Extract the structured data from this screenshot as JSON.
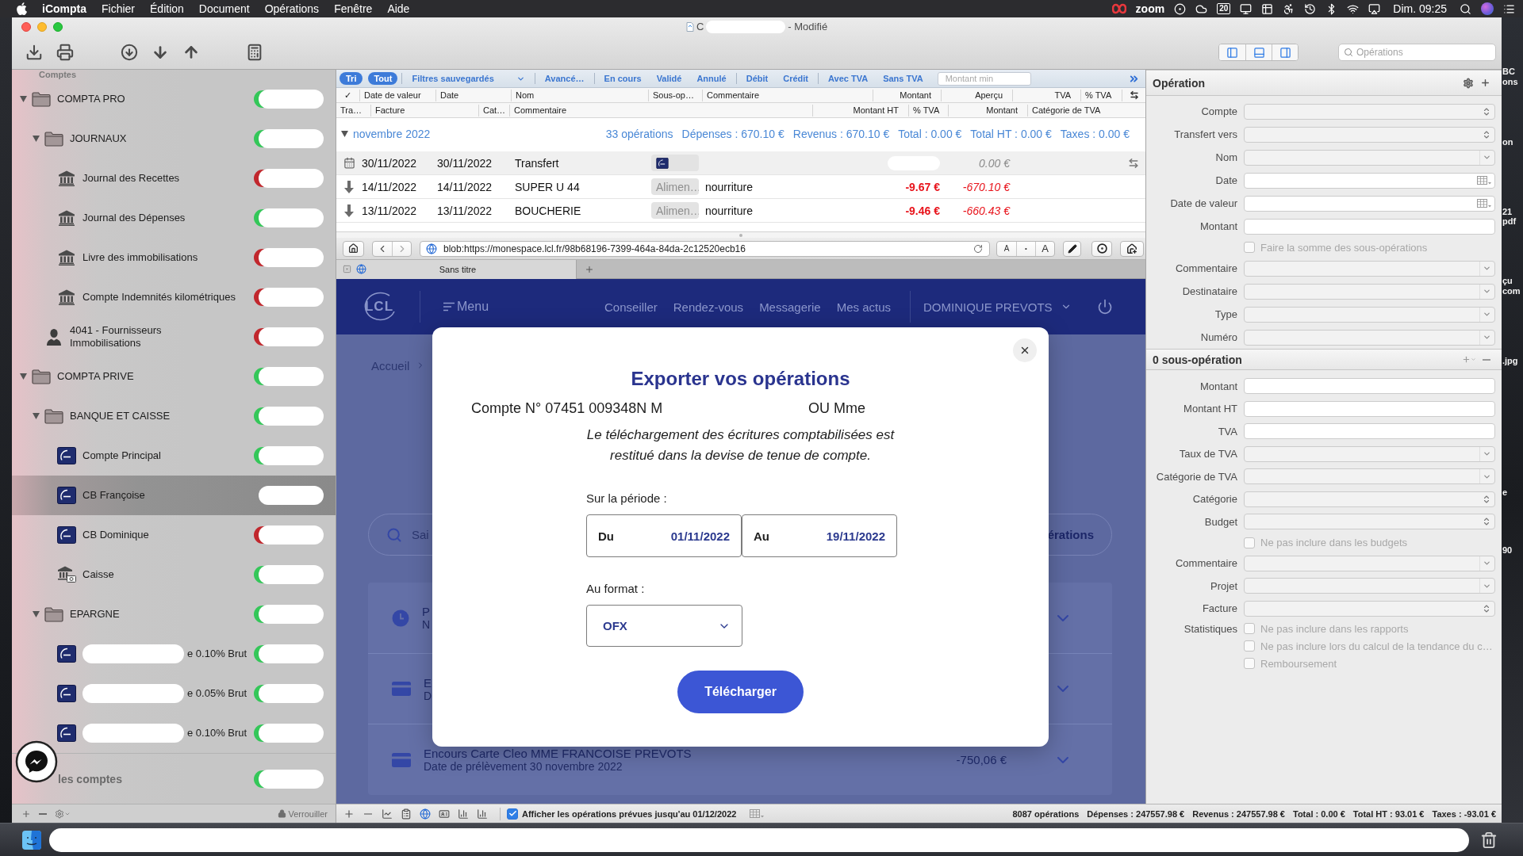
{
  "menu_bar": {
    "app": "iCompta",
    "menus": [
      "Fichier",
      "Édition",
      "Document",
      "Opérations",
      "Fenêtre",
      "Aide"
    ],
    "zoom_label": "zoom",
    "day_badge": "20",
    "clock": "Dim. 09:25"
  },
  "window": {
    "title_start": "C",
    "title_end": "- Modifié",
    "view_toggles": [
      {
        "on": true
      },
      {
        "on": true
      },
      {
        "on": true
      }
    ],
    "search": {
      "placeholder": "Opérations"
    }
  },
  "sidebar": {
    "heading": "Comptes",
    "items": [
      {
        "kind": "folder",
        "label": "COMPTA PRO",
        "expanded": true,
        "selected": false,
        "color": "#34c759",
        "children": [
          {
            "kind": "folder",
            "label": "JOURNAUX",
            "expanded": true,
            "selected": false,
            "color": "#34c759",
            "children": [
              {
                "kind": "bank",
                "label": "Journal des Recettes",
                "selected": false,
                "color": "#c1272d"
              },
              {
                "kind": "bank",
                "label": "Journal des Dépenses",
                "selected": false,
                "color": "#34c759"
              },
              {
                "kind": "bank",
                "label": "Livre des immobilisations",
                "selected": false,
                "color": "#c1272d"
              },
              {
                "kind": "bank",
                "label": "Compte Indemnités kilométriques",
                "selected": false,
                "color": "#c1272d"
              }
            ]
          },
          {
            "kind": "person",
            "label": "4041 - Fournisseurs Immobilisations",
            "selected": false,
            "color": "#c1272d"
          }
        ]
      },
      {
        "kind": "folder",
        "label": "COMPTA PRIVE",
        "expanded": true,
        "selected": false,
        "color": "#34c759",
        "children": [
          {
            "kind": "folder",
            "label": "BANQUE ET CAISSE",
            "expanded": true,
            "selected": false,
            "color": "#34c759",
            "children": [
              {
                "kind": "card",
                "label": "Compte Principal",
                "selected": false,
                "color": "#34c759"
              },
              {
                "kind": "card",
                "label": "CB Françoise",
                "selected": true
              },
              {
                "kind": "card",
                "label": "CB Dominique",
                "selected": false,
                "color": "#c1272d"
              },
              {
                "kind": "cash",
                "label": "Caisse",
                "selected": false,
                "color": "#34c759"
              }
            ]
          },
          {
            "kind": "folder",
            "label": "EPARGNE",
            "expanded": true,
            "selected": false,
            "color": "#34c759",
            "children": [
              {
                "kind": "card",
                "label": "e 0.10% Brut",
                "redacted": true,
                "selected": false,
                "color": "#34c759"
              },
              {
                "kind": "card",
                "label": "e 0.05% Brut",
                "redacted": true,
                "selected": false,
                "color": "#34c759"
              },
              {
                "kind": "card",
                "label": "e 0.10% Brut",
                "redacted": true,
                "selected": false,
                "color": "#34c759"
              }
            ]
          }
        ]
      }
    ],
    "total": {
      "label": "les comptes",
      "color": "#34c759"
    },
    "footer": {
      "lock_label": "Verrouiller"
    }
  },
  "filter_bar": {
    "sort_label": "Tri",
    "groups": [
      {
        "items": [
          {
            "kind": "toggle",
            "label": "Tout",
            "selected": true
          }
        ]
      },
      {
        "items": [
          {
            "kind": "menu",
            "label": "Filtres sauvegardés",
            "selected": false
          }
        ]
      },
      {
        "items": [
          {
            "kind": "toggle",
            "label": "Avancé…",
            "selected": false
          }
        ]
      },
      {
        "items": [
          {
            "kind": "toggle",
            "label": "En cours",
            "selected": false
          },
          {
            "kind": "toggle",
            "label": "Validé",
            "selected": false
          },
          {
            "kind": "toggle",
            "label": "Annulé",
            "selected": false
          }
        ]
      },
      {
        "items": [
          {
            "kind": "toggle",
            "label": "Débit",
            "selected": false
          },
          {
            "kind": "toggle",
            "label": "Crédit",
            "selected": false
          }
        ]
      },
      {
        "items": [
          {
            "kind": "toggle",
            "label": "Avec TVA",
            "selected": false
          },
          {
            "kind": "toggle",
            "label": "Sans TVA",
            "selected": false
          }
        ]
      }
    ],
    "amount_min": {
      "placeholder": "Montant min"
    }
  },
  "table": {
    "header_rows": [
      [
        "✓",
        "Date de valeur",
        "Date",
        "Nom",
        "Sous-op…",
        "Commentaire",
        "Montant",
        "Aperçu",
        "TVA",
        "% TVA"
      ],
      [
        "Tra…",
        "Facture",
        "Cat…",
        "Commentaire",
        "Montant HT",
        "% TVA",
        "Montant",
        "Catégorie de TVA"
      ]
    ],
    "group": {
      "label": "novembre 2022",
      "expanded": true,
      "summary": [
        "33 opérations",
        "Dépenses : 670.10 €",
        "Revenus : 670.10 €",
        "Total : 0.00 €",
        "Total HT : 0.00 €",
        "Taxes : 0.00 €"
      ]
    },
    "rows": [
      {
        "kind": "scheduled",
        "value_date": "30/11/2022",
        "date": "30/11/2022",
        "name": "Transfert",
        "sub_operation": {
          "kind": "logo"
        },
        "amount_hidden": true,
        "preview": "0.00 €",
        "transfer": true
      },
      {
        "kind": "debit",
        "value_date": "14/11/2022",
        "date": "14/11/2022",
        "name": "SUPER U 44",
        "sub_operation": {
          "kind": "text",
          "label": "Alimen…"
        },
        "comment": "nourriture",
        "amount": "-9.67 €",
        "amount_hidden": false,
        "preview": "-670.10 €",
        "transfer": false
      },
      {
        "kind": "debit",
        "value_date": "13/11/2022",
        "date": "13/11/2022",
        "name": "BOUCHERIE",
        "sub_operation": {
          "kind": "text",
          "label": "Alimen…"
        },
        "comment": "nourriture",
        "amount": "-9.46 €",
        "amount_hidden": false,
        "preview": "-660.43 €",
        "transfer": false
      }
    ]
  },
  "browser": {
    "url": "blob:https://monespace.lcl.fr/98b68196-7399-464a-84da-2c12520ecb16",
    "text_size_buttons": [
      "A",
      "•",
      "A"
    ],
    "tab": {
      "title": "Sans titre"
    },
    "page": {
      "logo": "LCL",
      "menu_label": "Menu",
      "nav": [
        "Conseiller",
        "Rendez-vous",
        "Messagerie",
        "Mes actus"
      ],
      "user": "DOMINIQUE PREVOTS",
      "breadcrumb": "Accueil",
      "search_placeholder": "Sai",
      "search_link": "érations",
      "cards": [
        {
          "kind": "clock",
          "title": "P",
          "subtitle": "N"
        },
        {
          "kind": "card",
          "title": "E",
          "subtitle": "D"
        },
        {
          "kind": "card",
          "title": "Encours Carte Cleo MME FRANCOISE PREVOTS",
          "subtitle": "Date de prélèvement 30 novembre 2022",
          "amount": "-750,06 €"
        }
      ]
    },
    "dialog": {
      "title": "Exporter vos opérations",
      "account_start": "Compte N° 07451 009348N M",
      "account_end": "OU Mme",
      "notice": "Le téléchargement des écritures comptabilisées est restitué dans la devise de tenue de compte.",
      "period_label": "Sur la période :",
      "from": {
        "label": "Du",
        "value": "01/11/2022"
      },
      "to": {
        "label": "Au",
        "value": "19/11/2022"
      },
      "format_label": "Au format :",
      "format": "OFX",
      "submit": "Télécharger"
    }
  },
  "inspector": {
    "title": "Opération",
    "fields": [
      {
        "kind": "stepper",
        "label": "Compte"
      },
      {
        "kind": "stepper",
        "label": "Transfert vers"
      },
      {
        "kind": "combo",
        "label": "Nom"
      },
      {
        "kind": "date",
        "label": "Date"
      },
      {
        "kind": "date",
        "label": "Date de valeur"
      },
      {
        "kind": "text",
        "label": "Montant"
      },
      {
        "kind": "checkbox",
        "text": "Faire la somme des sous-opérations",
        "checked": false,
        "disabled": true
      },
      {
        "kind": "combo",
        "label": "Commentaire"
      },
      {
        "kind": "combo",
        "label": "Destinataire"
      },
      {
        "kind": "combo",
        "label": "Type"
      },
      {
        "kind": "combo",
        "label": "Numéro"
      }
    ],
    "sub_title": "0 sous-opération",
    "sub_fields": [
      {
        "kind": "text",
        "label": "Montant"
      },
      {
        "kind": "text",
        "label": "Montant HT"
      },
      {
        "kind": "text",
        "label": "TVA"
      },
      {
        "kind": "combo",
        "label": "Taux de TVA"
      },
      {
        "kind": "combo",
        "label": "Catégorie de TVA"
      },
      {
        "kind": "stepper",
        "label": "Catégorie"
      },
      {
        "kind": "stepper",
        "label": "Budget"
      },
      {
        "kind": "checkbox",
        "text": "Ne pas inclure dans les budgets",
        "checked": false,
        "disabled": true
      },
      {
        "kind": "combo",
        "label": "Commentaire"
      },
      {
        "kind": "combo",
        "label": "Projet"
      },
      {
        "kind": "stepper",
        "label": "Facture"
      },
      {
        "kind": "checkbox",
        "label": "Statistiques",
        "text": "Ne pas inclure dans les rapports",
        "checked": false,
        "disabled": true
      },
      {
        "kind": "checkbox",
        "text": "Ne pas inclure lors du calcul de la tendance du c…",
        "checked": false,
        "disabled": true
      },
      {
        "kind": "checkbox",
        "text": "Remboursement",
        "checked": false,
        "disabled": true
      }
    ]
  },
  "status_bar": {
    "planned": {
      "label": "Afficher les opérations prévues jusqu'au 01/12/2022",
      "checked": true
    },
    "summary": [
      "8087 opérations",
      "Dépenses : 247557.98 €",
      "Revenus : 247557.98 €",
      "Total : 0.00 €",
      "Total HT : 93.01 €",
      "Taxes : -93.01 €"
    ]
  },
  "desktop_labels": [
    "BC",
    "ons",
    "on",
    "21",
    "pdf",
    "çu",
    "com",
    ".jpg",
    "e",
    "90"
  ]
}
